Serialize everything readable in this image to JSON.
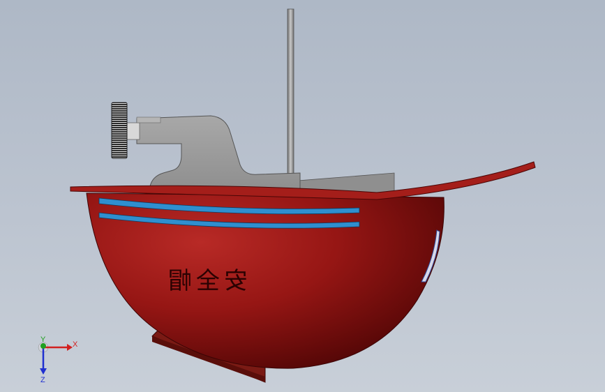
{
  "scene": {
    "helmet_lettering": "安全帽",
    "axes": {
      "x_label": "X",
      "y_label": "Y",
      "z_label": "Z"
    },
    "colors": {
      "background_top": "#aeb8c6",
      "background_bottom": "#c8cfd8",
      "helmet_red": "#9e1a18",
      "helmet_dark": "#5a0808",
      "stripe_blue": "#2f8fcf",
      "fixture_gray": "#9a9a9a",
      "axis_x": "#d22020",
      "axis_y": "#20a020",
      "axis_z": "#2030d0"
    }
  }
}
